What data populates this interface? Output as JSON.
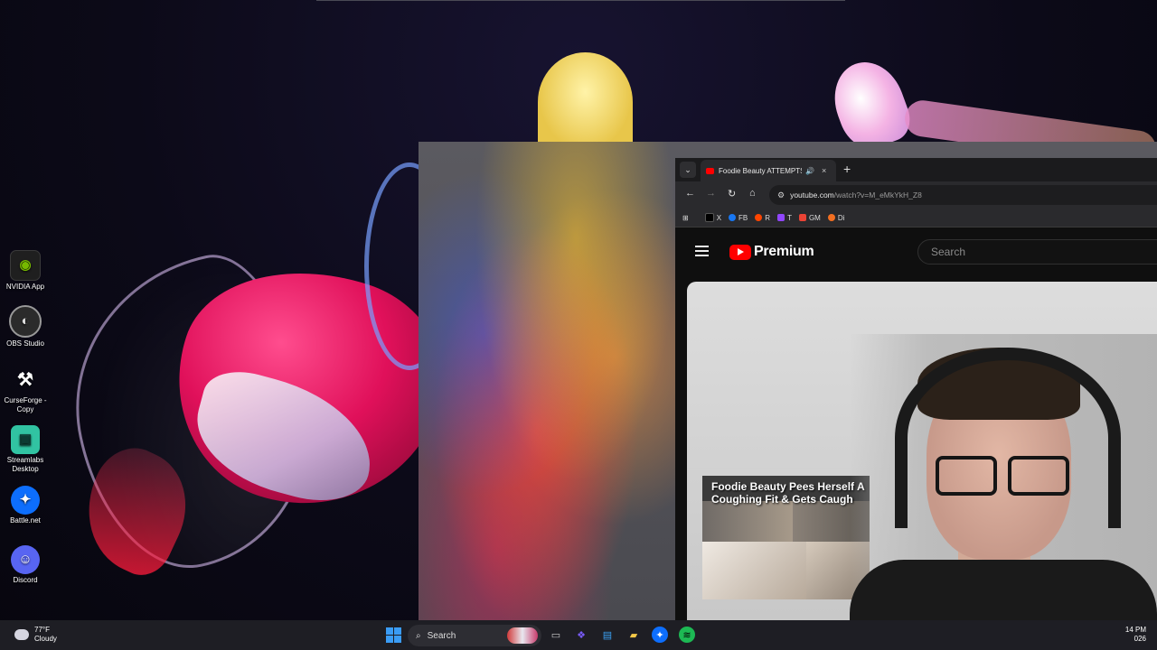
{
  "desktop": {
    "icons": [
      {
        "label": "NVIDIA App",
        "icon": "nvidia-icon"
      },
      {
        "label": "OBS Studio",
        "icon": "obs-icon"
      },
      {
        "label": "CurseForge - Copy",
        "icon": "curseforge-icon"
      },
      {
        "label": "Streamlabs Desktop",
        "icon": "streamlabs-icon"
      },
      {
        "label": "Battle.net",
        "icon": "battlenet-icon"
      },
      {
        "label": "Discord",
        "icon": "discord-icon"
      }
    ]
  },
  "browser": {
    "tab": {
      "title": "Foodie Beauty ATTEMPTS",
      "audio_icon": "speaker-icon",
      "close_glyph": "×"
    },
    "new_tab_glyph": "+",
    "tab_menu_glyph": "⌄",
    "address": {
      "host": "youtube.com",
      "path": "/watch?v=M_eMkYkH_Z8"
    },
    "bookmarks": [
      {
        "label": "X",
        "color": "#ffffff"
      },
      {
        "label": "FB",
        "color": "#1877f2"
      },
      {
        "label": "R",
        "color": "#ff4500"
      },
      {
        "label": "T",
        "color": "#9146ff"
      },
      {
        "label": "GM",
        "color": "#ea4335"
      },
      {
        "label": "Di",
        "color": "#f36f21"
      }
    ]
  },
  "youtube": {
    "brand": "Premium",
    "search_placeholder": "Search",
    "thumbnail_title_line1": "Foodie Beauty Pees Herself A",
    "thumbnail_title_line2": "Coughing Fit & Gets Caugh"
  },
  "taskbar": {
    "weather_temp": "77°F",
    "weather_condition": "Cloudy",
    "search_label": "Search",
    "clock_time": "14 PM",
    "clock_date": "026"
  },
  "colors": {
    "youtube_red": "#ff0000",
    "windows_blue": "#3a9cf5"
  }
}
